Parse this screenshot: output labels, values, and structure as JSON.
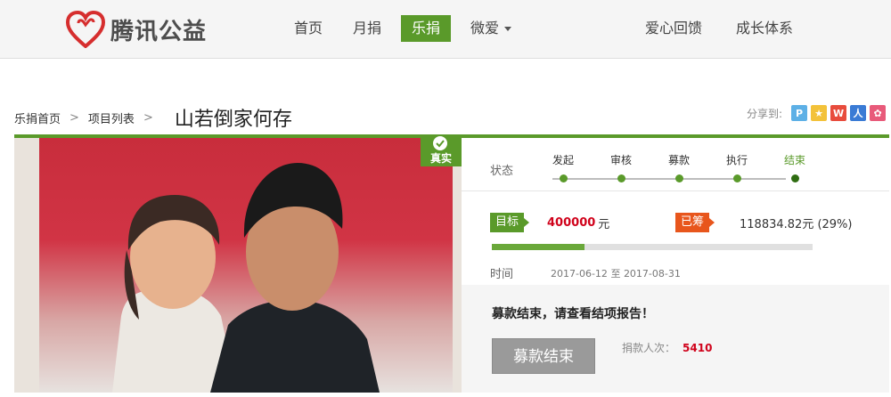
{
  "brand": {
    "name": "腾讯公益",
    "logo_icon": "heart-logo-icon",
    "color": "#d62e2e"
  },
  "nav": {
    "items": [
      {
        "label": "首页"
      },
      {
        "label": "月捐"
      },
      {
        "label": "乐捐",
        "active": true
      },
      {
        "label": "微爱",
        "has_dropdown": true
      }
    ],
    "right_items": [
      {
        "label": "爱心回馈"
      },
      {
        "label": "成长体系"
      }
    ],
    "active_color": "#5a9a2a"
  },
  "breadcrumb": {
    "items": [
      "乐捐首页",
      "项目列表"
    ],
    "separator": ">",
    "title": "山若倒家何存"
  },
  "share": {
    "label": "分享到:",
    "icons": [
      "qzone-icon",
      "friends-icon",
      "weibo-icon",
      "renren-icon",
      "kaixin-icon"
    ]
  },
  "project": {
    "badge": "真实",
    "status_label": "状态",
    "steps": [
      "发起",
      "审核",
      "募款",
      "执行",
      "结束"
    ],
    "current_step": 4,
    "target_tag": "目标",
    "target_amount": "400000",
    "currency": "元",
    "raised_tag": "已筹",
    "raised_amount": "118834.82元 (29%)",
    "progress_percent": 29,
    "time_label": "时间",
    "time_start": "2017-06-12",
    "time_sep": "至",
    "time_end": "2017-08-31",
    "end_message": "募款结束，请查看结项报告！",
    "end_button": "募款结束",
    "donors_label": "捐款人次：",
    "donors_count": "5410"
  }
}
